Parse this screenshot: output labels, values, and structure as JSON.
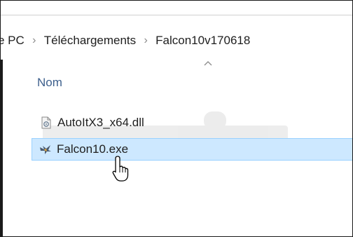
{
  "breadcrumb": {
    "items": [
      "e PC",
      "Téléchargements",
      "Falcon10v170618"
    ],
    "separator": "›"
  },
  "columns": {
    "name_header": "Nom"
  },
  "files": [
    {
      "name": "AutoItX3_x64.dll",
      "icon": "dll-file-icon",
      "selected": false
    },
    {
      "name": "Falcon10.exe",
      "icon": "falcon-exe-icon",
      "selected": true
    }
  ],
  "colors": {
    "selection_fill": "#cde8ff",
    "selection_border": "#99d1ff",
    "header_text": "#3d5f8c"
  }
}
